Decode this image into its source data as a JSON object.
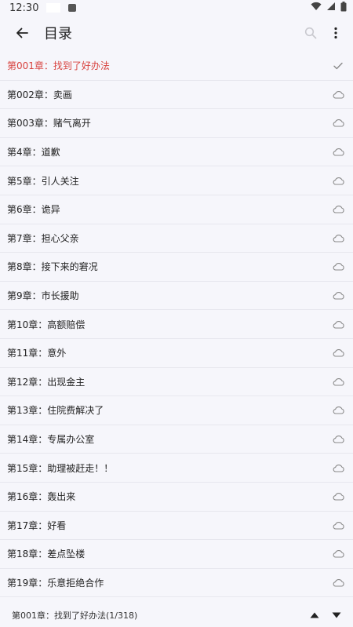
{
  "status_bar": {
    "time": "12:30",
    "notification_icons": [
      "app-notification-icon",
      "letter-a-icon"
    ],
    "right_icons": [
      "wifi-icon",
      "signal-icon",
      "battery-icon"
    ]
  },
  "app_bar": {
    "title": "目录",
    "icons": [
      "back-arrow-icon",
      "search-icon",
      "more-vert-icon"
    ]
  },
  "chapters": [
    {
      "label": "第001章：找到了好办法",
      "status": "current"
    },
    {
      "label": "第002章：卖画",
      "status": "cloud"
    },
    {
      "label": "第003章：赌气离开",
      "status": "cloud"
    },
    {
      "label": "第4章：道歉",
      "status": "cloud"
    },
    {
      "label": "第5章：引人关注",
      "status": "cloud"
    },
    {
      "label": "第6章：诡异",
      "status": "cloud"
    },
    {
      "label": "第7章：担心父亲",
      "status": "cloud"
    },
    {
      "label": "第8章：接下来的窘况",
      "status": "cloud"
    },
    {
      "label": "第9章：市长援助",
      "status": "cloud"
    },
    {
      "label": "第10章：高额赔偿",
      "status": "cloud"
    },
    {
      "label": "第11章：意外",
      "status": "cloud"
    },
    {
      "label": "第12章：出现金主",
      "status": "cloud"
    },
    {
      "label": "第13章：住院费解决了",
      "status": "cloud"
    },
    {
      "label": "第14章：专属办公室",
      "status": "cloud"
    },
    {
      "label": "第15章：助理被赶走！！",
      "status": "cloud"
    },
    {
      "label": "第16章：轰出来",
      "status": "cloud"
    },
    {
      "label": "第17章：好看",
      "status": "cloud"
    },
    {
      "label": "第18章：差点坠楼",
      "status": "cloud"
    },
    {
      "label": "第19章：乐意拒绝合作",
      "status": "cloud"
    }
  ],
  "bottom_bar": {
    "current_text": "第001章：找到了好办法(1/318)",
    "icons": [
      "arrow-up-icon",
      "arrow-down-icon"
    ]
  },
  "colors": {
    "background": "#f6f6fb",
    "current_chapter": "#d8433f",
    "divider": "#e7e7ee",
    "icon": "#8a8a8a"
  }
}
